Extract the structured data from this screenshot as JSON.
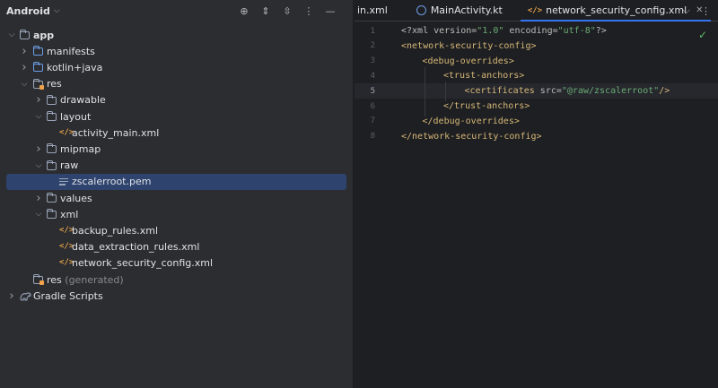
{
  "project_panel": {
    "title": "Android",
    "tree": [
      {
        "label": "app",
        "depth": 0,
        "expanded": true,
        "icon": "app-module-folder-icon"
      },
      {
        "label": "manifests",
        "depth": 1,
        "expanded": false,
        "icon": "folder-icon"
      },
      {
        "label": "kotlin+java",
        "depth": 1,
        "expanded": false,
        "icon": "folder-icon"
      },
      {
        "label": "res",
        "depth": 1,
        "expanded": true,
        "icon": "res-folder-icon"
      },
      {
        "label": "drawable",
        "depth": 2,
        "expanded": false,
        "icon": "folder-icon"
      },
      {
        "label": "layout",
        "depth": 2,
        "expanded": true,
        "icon": "folder-icon"
      },
      {
        "label": "activity_main.xml",
        "depth": 3,
        "icon": "xml-file-icon"
      },
      {
        "label": "mipmap",
        "depth": 2,
        "expanded": false,
        "icon": "folder-icon"
      },
      {
        "label": "raw",
        "depth": 2,
        "expanded": true,
        "icon": "folder-icon"
      },
      {
        "label": "zscalerroot.pem",
        "depth": 3,
        "icon": "text-file-icon",
        "selected": true
      },
      {
        "label": "values",
        "depth": 2,
        "expanded": false,
        "icon": "folder-icon"
      },
      {
        "label": "xml",
        "depth": 2,
        "expanded": true,
        "icon": "folder-icon"
      },
      {
        "label": "backup_rules.xml",
        "depth": 3,
        "icon": "xml-file-icon"
      },
      {
        "label": "data_extraction_rules.xml",
        "depth": 3,
        "icon": "xml-file-icon"
      },
      {
        "label": "network_security_config.xml",
        "depth": 3,
        "icon": "xml-file-icon"
      },
      {
        "label": "res",
        "suffix": "(generated)",
        "depth": 1,
        "icon": "res-folder-icon"
      },
      {
        "label": "Gradle Scripts",
        "depth": 0,
        "expanded": false,
        "icon": "gradle-icon"
      }
    ]
  },
  "editor": {
    "tabs": [
      {
        "label": "in.xml",
        "icon": "none"
      },
      {
        "label": "MainActivity.kt",
        "icon": "kotlin-file-icon"
      },
      {
        "label": "network_security_config.xml",
        "icon": "xml-file-icon",
        "active": true
      }
    ],
    "current_line": 5,
    "lines": [
      {
        "n": "1",
        "indent": 0,
        "tokens": [
          [
            "pi",
            "<?xml "
          ],
          [
            "attr",
            "version="
          ],
          [
            "str",
            "\"1.0\""
          ],
          [
            "attr",
            " encoding="
          ],
          [
            "str",
            "\"utf-8\""
          ],
          [
            "pi",
            "?>"
          ]
        ]
      },
      {
        "n": "2",
        "indent": 0,
        "tokens": [
          [
            "tag",
            "<network-security-config>"
          ]
        ]
      },
      {
        "n": "3",
        "indent": 1,
        "tokens": [
          [
            "tag",
            "<debug-overrides>"
          ]
        ]
      },
      {
        "n": "4",
        "indent": 2,
        "tokens": [
          [
            "tag",
            "<trust-anchors>"
          ]
        ]
      },
      {
        "n": "5",
        "indent": 3,
        "tokens": [
          [
            "tag",
            "<certificates "
          ],
          [
            "attr",
            "src="
          ],
          [
            "str",
            "\"@raw/zscalerroot\""
          ],
          [
            "tag",
            "/>"
          ]
        ]
      },
      {
        "n": "6",
        "indent": 2,
        "tokens": [
          [
            "tag",
            "</trust-anchors>"
          ]
        ]
      },
      {
        "n": "7",
        "indent": 1,
        "tokens": [
          [
            "tag",
            "</debug-overrides>"
          ]
        ]
      },
      {
        "n": "8",
        "indent": 0,
        "tokens": [
          [
            "tag",
            "</network-security-config>"
          ]
        ]
      }
    ]
  },
  "colors": {
    "panel_bg": "#2b2d30",
    "editor_bg": "#1e1f22",
    "selection": "#2e436e",
    "tag": "#d5b778",
    "string": "#6aab73",
    "accent": "#3574f0"
  }
}
